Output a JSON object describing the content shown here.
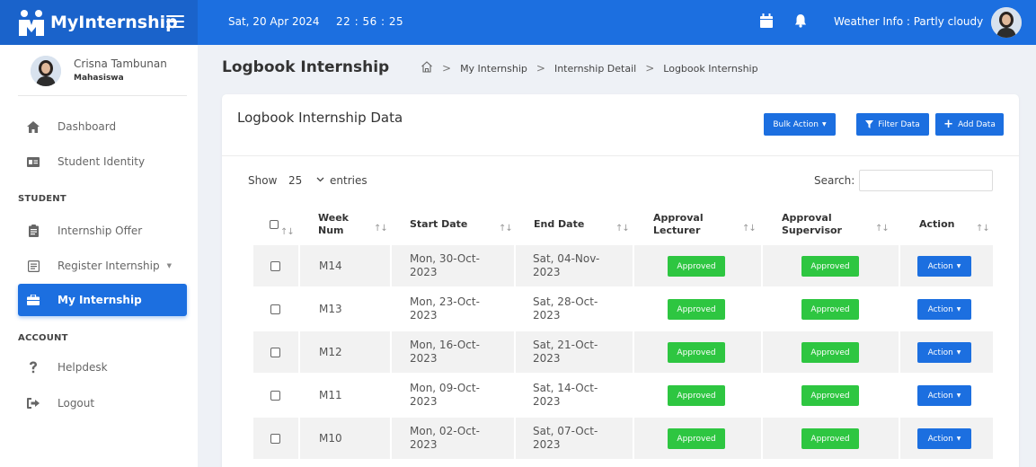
{
  "brand": {
    "name": "MyInternship"
  },
  "topbar": {
    "date": "Sat, 20 Apr 2024",
    "time": "22 : 56 : 25",
    "weather": "Weather Info : Partly cloudy"
  },
  "colors": {
    "primary": "#1c6fe0",
    "approved": "#2ec641",
    "sidebar_bg": "#ffffff",
    "page_bg": "#eef1f6"
  },
  "profile": {
    "name": "Crisna Tambunan",
    "role": "Mahasiswa"
  },
  "sidebar": {
    "items": [
      {
        "label": "Dashboard",
        "icon": "home-icon"
      },
      {
        "label": "Student Identity",
        "icon": "id-card-icon"
      },
      {
        "label": "Internship Offer",
        "icon": "clipboard-icon"
      },
      {
        "label": "Register Internship",
        "icon": "form-icon"
      },
      {
        "label": "My Internship",
        "icon": "briefcase-icon"
      },
      {
        "label": "Helpdesk",
        "icon": "question-icon"
      },
      {
        "label": "Logout",
        "icon": "logout-icon"
      }
    ],
    "sections": {
      "student": "STUDENT",
      "account": "ACCOUNT"
    }
  },
  "page": {
    "title": "Logbook Internship",
    "breadcrumb": [
      "My Internship",
      "Internship Detail",
      "Logbook Internship"
    ]
  },
  "card": {
    "title": "Logbook Internship Data",
    "bulk_action": "Bulk Action",
    "filter_data": "Filter Data",
    "add_data": "Add Data"
  },
  "table_controls": {
    "show": "Show",
    "entries_value": "25",
    "entries": "entries",
    "search": "Search:"
  },
  "table": {
    "headers": {
      "week_1": "Week",
      "week_2": "Num",
      "start": "Start Date",
      "end": "End Date",
      "lect_1": "Approval",
      "lect_2": "Lecturer",
      "sup_1": "Approval",
      "sup_2": "Supervisor",
      "action": "Action"
    },
    "rows": [
      {
        "week": "M14",
        "start_1": "Mon, 30-Oct-",
        "start_2": "2023",
        "end_1": "Sat, 04-Nov-",
        "end_2": "2023",
        "lecturer": "Approved",
        "supervisor": "Approved",
        "action": "Action"
      },
      {
        "week": "M13",
        "start_1": "Mon, 23-Oct-",
        "start_2": "2023",
        "end_1": "Sat, 28-Oct-",
        "end_2": "2023",
        "lecturer": "Approved",
        "supervisor": "Approved",
        "action": "Action"
      },
      {
        "week": "M12",
        "start_1": "Mon, 16-Oct-",
        "start_2": "2023",
        "end_1": "Sat, 21-Oct-",
        "end_2": "2023",
        "lecturer": "Approved",
        "supervisor": "Approved",
        "action": "Action"
      },
      {
        "week": "M11",
        "start_1": "Mon, 09-Oct-",
        "start_2": "2023",
        "end_1": "Sat, 14-Oct-",
        "end_2": "2023",
        "lecturer": "Approved",
        "supervisor": "Approved",
        "action": "Action"
      },
      {
        "week": "M10",
        "start_1": "Mon, 02-Oct-",
        "start_2": "2023",
        "end_1": "Sat, 07-Oct-",
        "end_2": "2023",
        "lecturer": "Approved",
        "supervisor": "Approved",
        "action": "Action"
      }
    ]
  }
}
